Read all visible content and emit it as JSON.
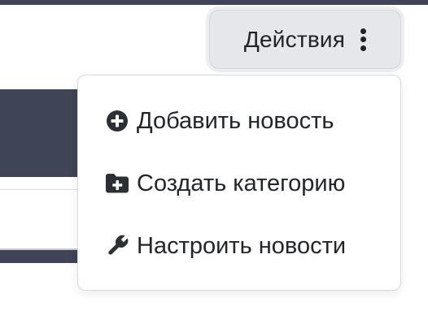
{
  "actions": {
    "label": "Действия",
    "icon": "kebab-vertical-icon"
  },
  "menu": {
    "items": [
      {
        "label": "Добавить новость",
        "icon": "plus-circle-icon"
      },
      {
        "label": "Создать категорию",
        "icon": "folder-plus-icon"
      },
      {
        "label": "Настроить новости",
        "icon": "wrench-icon"
      }
    ]
  },
  "colors": {
    "dark_panel": "#3f4456",
    "button_bg": "#e5e7ea",
    "text": "#22262b",
    "menu_border": "#d7dade"
  }
}
